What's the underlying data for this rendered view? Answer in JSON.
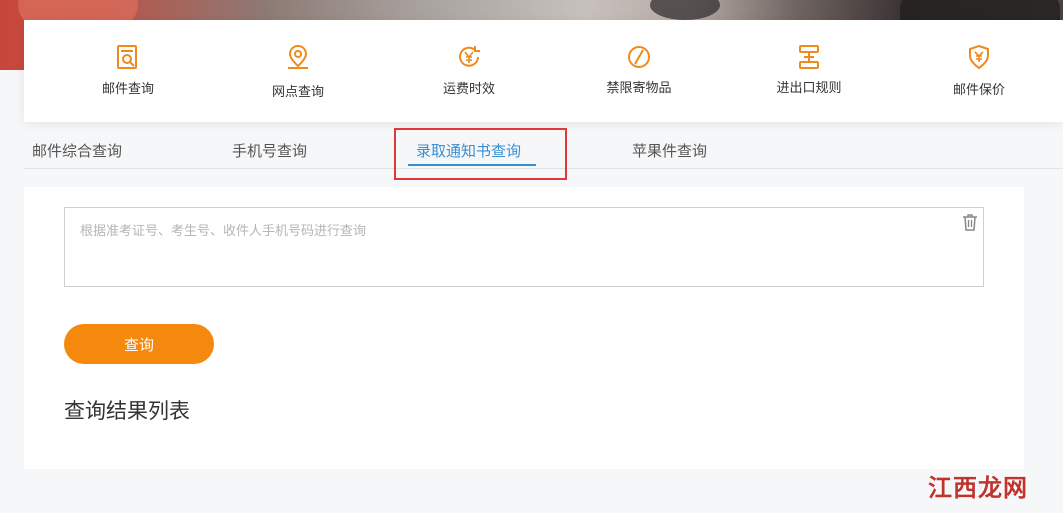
{
  "services": [
    {
      "label": "邮件查询",
      "icon": "mail-search-icon"
    },
    {
      "label": "网点查询",
      "icon": "location-pin-icon"
    },
    {
      "label": "运费时效",
      "icon": "yuan-clock-icon"
    },
    {
      "label": "禁限寄物品",
      "icon": "prohibited-icon"
    },
    {
      "label": "进出口规则",
      "icon": "import-export-icon"
    },
    {
      "label": "邮件保价",
      "icon": "yuan-shield-icon"
    }
  ],
  "tabs": [
    {
      "label": "邮件综合查询"
    },
    {
      "label": "手机号查询"
    },
    {
      "label": "录取通知书查询"
    },
    {
      "label": "苹果件查询"
    }
  ],
  "active_tab": "录取通知书查询",
  "query": {
    "placeholder": "根据准考证号、考生号、收件人手机号码进行查询",
    "value": "",
    "button_label": "查询"
  },
  "results": {
    "title": "查询结果列表"
  },
  "watermark": {
    "text": "江西龙网"
  },
  "colors": {
    "accent": "#f5890d",
    "active_tab": "#3a8fd1",
    "highlight": "#e0373b"
  }
}
